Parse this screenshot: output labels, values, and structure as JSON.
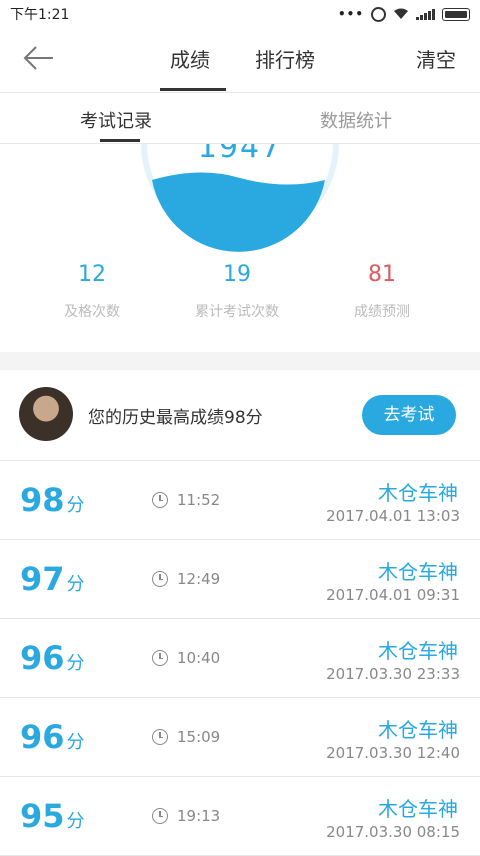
{
  "status_bar": {
    "time": "下午1:21"
  },
  "nav": {
    "back_icon": "arrow-left-icon",
    "tab_score": "成绩",
    "tab_rank": "排行榜",
    "clear": "清空"
  },
  "subtabs": {
    "record": "考试记录",
    "stats": "数据统计"
  },
  "gauge": {
    "value": "1947"
  },
  "stats": {
    "pass": {
      "value": "12",
      "label": "及格次数"
    },
    "total": {
      "value": "19",
      "label": "累计考试次数"
    },
    "predict": {
      "value": "81",
      "label": "成绩预测"
    }
  },
  "best": {
    "text": "您的历史最高成绩98分",
    "button": "去考试"
  },
  "records": [
    {
      "score": "98",
      "unit": "分",
      "duration": "11:52",
      "name": "木仓车神",
      "date": "2017.04.01  13:03"
    },
    {
      "score": "97",
      "unit": "分",
      "duration": "12:49",
      "name": "木仓车神",
      "date": "2017.04.01  09:31"
    },
    {
      "score": "96",
      "unit": "分",
      "duration": "10:40",
      "name": "木仓车神",
      "date": "2017.03.30  23:33"
    },
    {
      "score": "96",
      "unit": "分",
      "duration": "15:09",
      "name": "木仓车神",
      "date": "2017.03.30  12:40"
    },
    {
      "score": "95",
      "unit": "分",
      "duration": "19:13",
      "name": "木仓车神",
      "date": "2017.03.30  08:15"
    }
  ],
  "colors": {
    "accent": "#2aa8e0",
    "predict": "#e0595e"
  }
}
